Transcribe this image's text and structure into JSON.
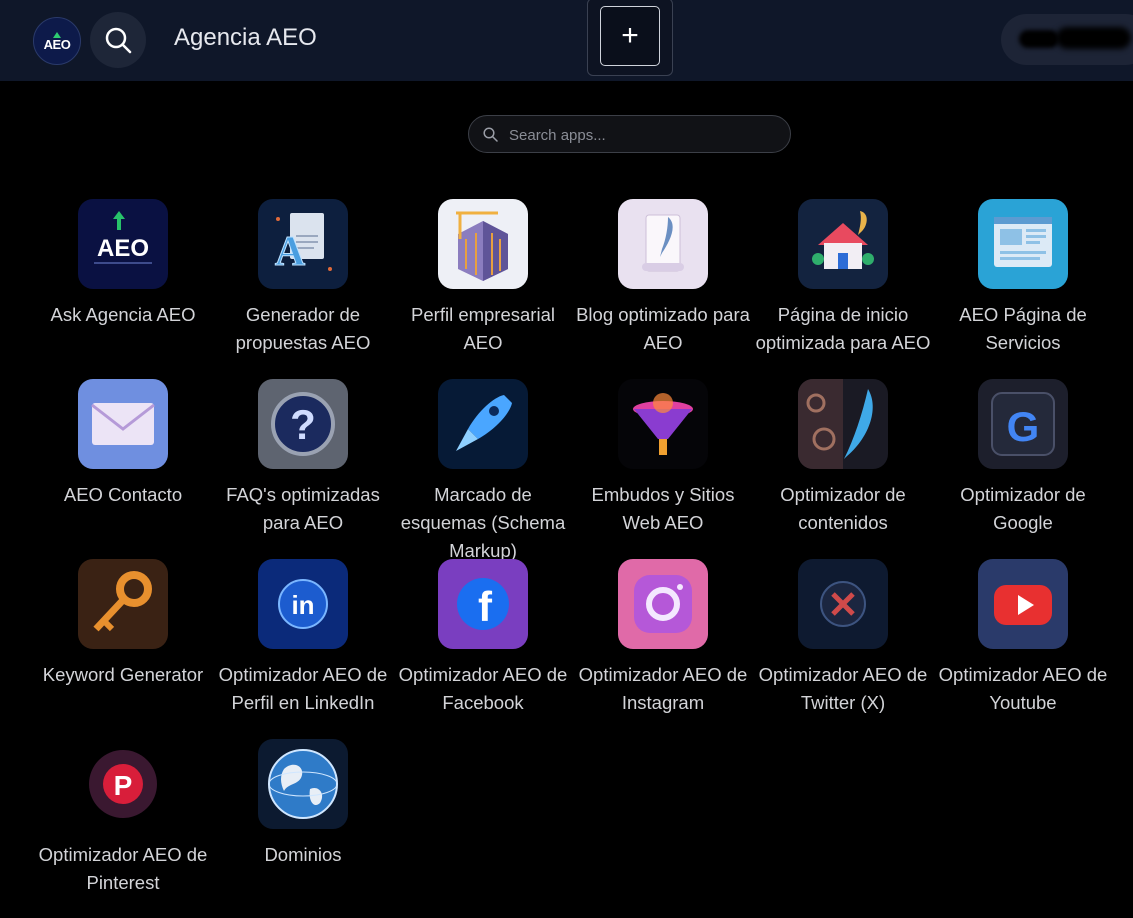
{
  "header": {
    "logo_text": "AEO",
    "title": "Agencia AEO",
    "plus_label": "+"
  },
  "search": {
    "placeholder": "Search apps..."
  },
  "icons": {
    "search": "search-icon",
    "plus": "plus-icon"
  },
  "apps": [
    {
      "label": "Ask Agencia AEO",
      "icon": "aeo-logo-icon"
    },
    {
      "label": "Generador de propuestas AEO",
      "icon": "document-a-icon"
    },
    {
      "label": "Perfil empresarial AEO",
      "icon": "building-construction-icon"
    },
    {
      "label": "Blog optimizado para AEO",
      "icon": "quill-scroll-icon"
    },
    {
      "label": "Página de inicio optimizada para AEO",
      "icon": "house-icon"
    },
    {
      "label": "AEO Página de Servicios",
      "icon": "webpage-layout-icon"
    },
    {
      "label": "AEO Contacto",
      "icon": "envelope-icon"
    },
    {
      "label": "FAQ's optimizadas para AEO",
      "icon": "question-mark-icon"
    },
    {
      "label": "Marcado de esquemas (Schema Markup)",
      "icon": "rocket-icon"
    },
    {
      "label": "Embudos y Sitios Web AEO",
      "icon": "funnel-icon"
    },
    {
      "label": "Optimizador de contenidos",
      "icon": "feather-pattern-icon"
    },
    {
      "label": "Optimizador de Google",
      "icon": "google-icon"
    },
    {
      "label": "Keyword Generator",
      "icon": "key-icon"
    },
    {
      "label": "Optimizador AEO de Perfil en LinkedIn",
      "icon": "linkedin-icon"
    },
    {
      "label": "Optimizador AEO de Facebook",
      "icon": "facebook-icon"
    },
    {
      "label": "Optimizador AEO de Instagram",
      "icon": "instagram-icon"
    },
    {
      "label": "Optimizador AEO de Twitter (X)",
      "icon": "x-twitter-icon"
    },
    {
      "label": "Optimizador AEO de Youtube",
      "icon": "youtube-icon"
    },
    {
      "label": "Optimizador AEO de Pinterest",
      "icon": "pinterest-icon"
    },
    {
      "label": "Dominios",
      "icon": "globe-icon"
    }
  ],
  "colors": {
    "background": "#000000",
    "topbar": "#0f1729",
    "label": "#d3d4d8"
  }
}
